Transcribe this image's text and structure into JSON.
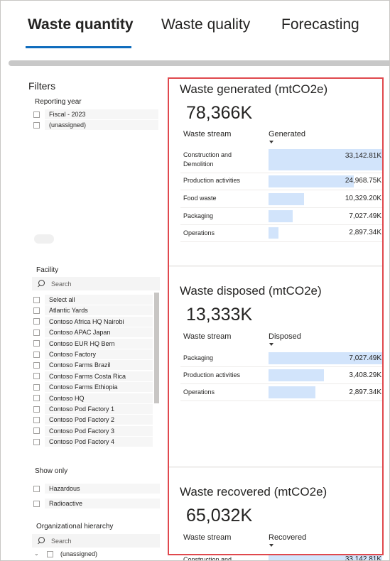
{
  "tabs": [
    {
      "label": "Waste quantity",
      "active": true
    },
    {
      "label": "Waste quality",
      "active": false
    },
    {
      "label": "Forecasting",
      "active": false
    }
  ],
  "filters": {
    "title": "Filters",
    "reporting_year": {
      "label": "Reporting year",
      "options": [
        "Fiscal - 2023",
        "(unassigned)"
      ]
    },
    "facility": {
      "label": "Facility",
      "search_placeholder": "Search",
      "options": [
        "Select all",
        "Atlantic Yards",
        "Contoso Africa HQ Nairobi",
        "Contoso APAC Japan",
        "Contoso EUR HQ Bern",
        "Contoso Factory",
        "Contoso Farms Brazil",
        "Contoso Farms Costa Rica",
        "Contoso Farms Ethiopia",
        "Contoso HQ",
        "Contoso Pod Factory 1",
        "Contoso Pod Factory 2",
        "Contoso Pod Factory 3",
        "Contoso Pod Factory 4"
      ]
    },
    "show_only": {
      "label": "Show only",
      "options": [
        "Hazardous",
        "Radioactive"
      ]
    },
    "org_hierarchy": {
      "label": "Organizational hierarchy",
      "search_placeholder": "Search",
      "first_item": "(unassigned)"
    }
  },
  "cards": {
    "generated": {
      "title": "Waste generated (mtCO2e)",
      "kpi": "78,366K",
      "col_stream": "Waste stream",
      "col_value": "Generated",
      "rows": [
        {
          "label": "Construction and Demolition",
          "value": "33,142.81K",
          "fraction": 1.0
        },
        {
          "label": "Production activities",
          "value": "24,968.75K",
          "fraction": 0.753
        },
        {
          "label": "Food waste",
          "value": "10,329.20K",
          "fraction": 0.312
        },
        {
          "label": "Packaging",
          "value": "7,027.49K",
          "fraction": 0.212
        },
        {
          "label": "Operations",
          "value": "2,897.34K",
          "fraction": 0.087
        }
      ]
    },
    "disposed": {
      "title": "Waste disposed (mtCO2e)",
      "kpi": "13,333K",
      "col_stream": "Waste stream",
      "col_value": "Disposed",
      "rows": [
        {
          "label": "Packaging",
          "value": "7,027.49K",
          "fraction": 1.0
        },
        {
          "label": "Production activities",
          "value": "3,408.29K",
          "fraction": 0.485
        },
        {
          "label": "Operations",
          "value": "2,897.34K",
          "fraction": 0.412
        }
      ]
    },
    "recovered": {
      "title": "Waste recovered (mtCO2e)",
      "kpi": "65,032K",
      "col_stream": "Waste stream",
      "col_value": "Recovered",
      "rows": [
        {
          "label": "Construction and",
          "value": "33,142.81K",
          "fraction": 1.0
        }
      ]
    }
  },
  "colors": {
    "accent": "#0f6cbd",
    "bar": "#d2e4fb",
    "highlight": "#e0484d"
  }
}
